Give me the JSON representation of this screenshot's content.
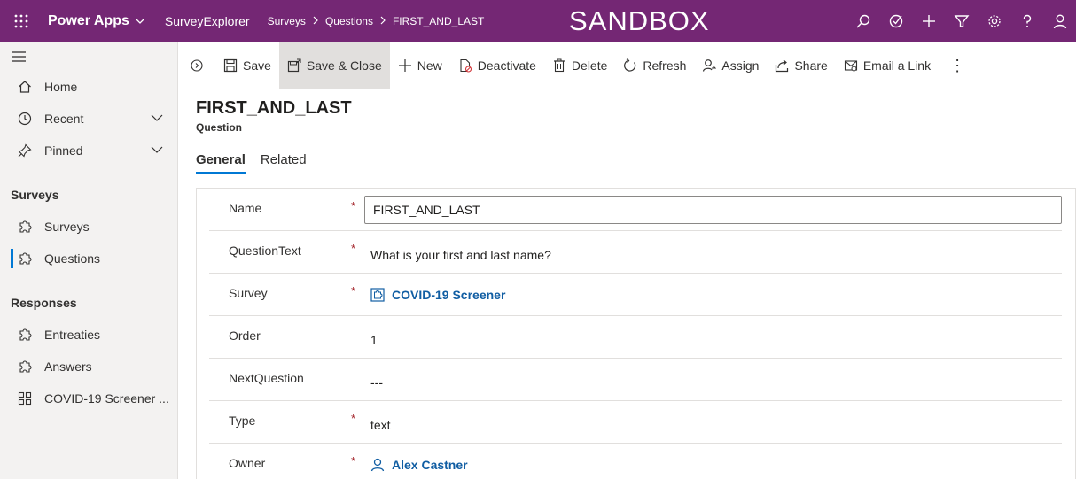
{
  "topbar": {
    "app_name": "Power Apps",
    "app_module": "SurveyExplorer",
    "breadcrumbs": [
      "Surveys",
      "Questions",
      "FIRST_AND_LAST"
    ],
    "environment": "SANDBOX",
    "color": "#742774",
    "icons": [
      "search-icon",
      "assistant-icon",
      "add-icon",
      "filter-icon",
      "settings-icon",
      "help-icon",
      "user-icon"
    ]
  },
  "sidebar": {
    "home": "Home",
    "recent": "Recent",
    "pinned": "Pinned",
    "group_surveys": "Surveys",
    "item_surveys": "Surveys",
    "item_questions": "Questions",
    "group_responses": "Responses",
    "item_entreaties": "Entreaties",
    "item_answers": "Answers",
    "item_covid": "COVID-19 Screener ...",
    "active_item": "Questions",
    "accent": "#0078d4"
  },
  "commands": {
    "save": "Save",
    "save_close": "Save & Close",
    "new": "New",
    "deactivate": "Deactivate",
    "delete": "Delete",
    "refresh": "Refresh",
    "assign": "Assign",
    "share": "Share",
    "email_link": "Email a Link",
    "more": "⋮"
  },
  "record": {
    "title": "FIRST_AND_LAST",
    "entity": "Question"
  },
  "tabs": {
    "general": "General",
    "related": "Related",
    "selected": "General"
  },
  "form": {
    "name_label": "Name",
    "name_value": "FIRST_AND_LAST",
    "questiontext_label": "QuestionText",
    "questiontext_value": "What is your first and last name?",
    "survey_label": "Survey",
    "survey_value": "COVID-19 Screener",
    "order_label": "Order",
    "order_value": "1",
    "nextquestion_label": "NextQuestion",
    "nextquestion_value": "---",
    "type_label": "Type",
    "type_value": "text",
    "owner_label": "Owner",
    "owner_value": "Alex Castner",
    "required_mark": "*"
  }
}
